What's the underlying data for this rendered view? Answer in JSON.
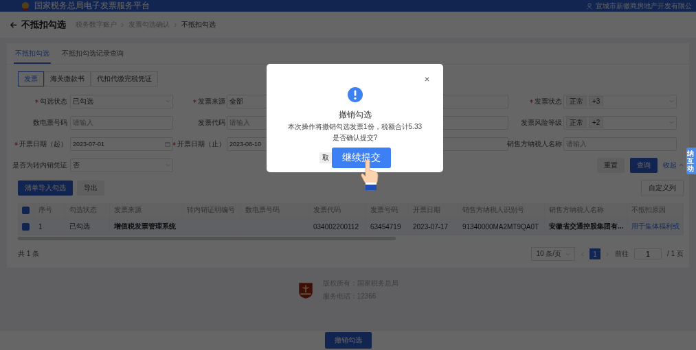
{
  "header": {
    "title": "国家税务总局电子发票服务平台",
    "user": "宣城市新徽商房地产开发有限公"
  },
  "page": {
    "title": "不抵扣勾选",
    "breadcrumb": [
      "税务数字账户",
      "发票勾选确认",
      "不抵扣勾选"
    ]
  },
  "tabs": [
    {
      "label": "不抵扣勾选",
      "selected": true
    },
    {
      "label": "不抵扣勾选记录查询",
      "selected": false
    }
  ],
  "subtabs": [
    {
      "label": "发票",
      "selected": true
    },
    {
      "label": "海关缴款书",
      "selected": false
    },
    {
      "label": "代扣代缴完税凭证",
      "selected": false
    }
  ],
  "filters": [
    [
      {
        "label": "勾选状态",
        "required": true,
        "kind": "select",
        "value": "已勾选"
      },
      {
        "label": "发票来源",
        "required": true,
        "kind": "select",
        "value": "全部"
      },
      {
        "kind": "input"
      },
      {
        "label": "发票状态",
        "required": true,
        "kind": "tags",
        "tags": [
          "正常",
          "+3"
        ]
      }
    ],
    [
      {
        "label": "数电票号码",
        "required": false,
        "kind": "input",
        "placeholder": "请输入"
      },
      {
        "label": "发票代码",
        "required": false,
        "kind": "input",
        "placeholder": "请输入"
      },
      {
        "kind": "input"
      },
      {
        "label": "发票风险等级",
        "required": false,
        "kind": "tags",
        "tags": [
          "正常",
          "+2"
        ]
      }
    ],
    [
      {
        "label": "开票日期（起）",
        "required": true,
        "kind": "date",
        "value": "2023-07-01",
        "calendar": true
      },
      {
        "label": "开票日期（止）",
        "required": true,
        "kind": "date",
        "value": "2023-08-10"
      },
      {
        "kind": "input"
      },
      {
        "label": "销售方纳税人名称",
        "required": false,
        "kind": "input",
        "placeholder": "请输入"
      }
    ],
    [
      {
        "label": "是否为转内销凭证",
        "required": false,
        "kind": "select",
        "value": "否"
      }
    ]
  ],
  "filter_actions": {
    "reset": "重置",
    "query": "查询",
    "collapse": "收起"
  },
  "toolbar": {
    "import": "清单导入勾选",
    "export": "导出",
    "columns": "自定义列"
  },
  "table": {
    "select_all": {
      "checked": true
    },
    "columns": [
      "序号",
      "勾选状态",
      "发票来源",
      "转内销证明编号",
      "数电票号码",
      "发票代码",
      "发票号码",
      "开票日期",
      "销售方纳税人识别号",
      "销售方纳税人名称",
      "不抵扣原因"
    ],
    "rows": [
      {
        "checked": true,
        "cells": [
          {
            "kind": "text",
            "text": "1"
          },
          {
            "kind": "text",
            "text": "已勾选"
          },
          {
            "kind": "strong",
            "text": "增值税发票管理系统"
          },
          {
            "kind": "empty"
          },
          {
            "kind": "empty"
          },
          {
            "kind": "text",
            "text": "034002200112"
          },
          {
            "kind": "text",
            "text": "63454719"
          },
          {
            "kind": "text",
            "text": "2023-07-17"
          },
          {
            "kind": "text",
            "text": "91340000MA2MT9QA0T"
          },
          {
            "kind": "strong",
            "text": "安徽省交通控股集团有..."
          },
          {
            "kind": "link",
            "text": "用于集体福利或"
          }
        ]
      }
    ]
  },
  "pagination": {
    "total": "共 1 条",
    "page_size": "10 条/页",
    "pages": [
      {
        "label": "1",
        "selected": true
      }
    ],
    "goto_label": "前往",
    "goto_value": "1",
    "page_count": "/ 1 页"
  },
  "footer": {
    "copyright": "版权所有：国家税务总局",
    "phone": "服务电话：12366"
  },
  "bottom_bar": {
    "button": "撤销勾选"
  },
  "side_widget": {
    "label": "纳互动"
  },
  "dialog": {
    "title": "撤销勾选",
    "message": [
      "本次操作将撤销勾选发票1份，税额合计5.33",
      "是否确认提交?"
    ],
    "cancel": "取",
    "confirm": "继续提交"
  }
}
